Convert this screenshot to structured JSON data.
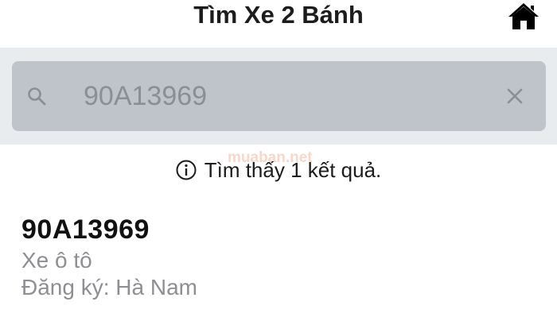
{
  "header": {
    "title": "Tìm Xe 2 Bánh",
    "home_icon": "home-icon"
  },
  "search": {
    "value": "90A13969",
    "search_icon": "search-icon",
    "clear_icon": "close-icon"
  },
  "results": {
    "count_text": "Tìm thấy 1 kết quả.",
    "info_icon": "info-icon",
    "items": [
      {
        "plate": "90A13969",
        "vehicle_type": "Xe ô tô",
        "registration_label": "Đăng ký:",
        "registration_place": "Hà Nam"
      }
    ]
  },
  "watermark": {
    "text": "muaban.net"
  },
  "colors": {
    "search_bar_bg": "#e9ecef",
    "search_field_bg": "#bfc4cb",
    "secondary_text": "#8e8e93"
  }
}
